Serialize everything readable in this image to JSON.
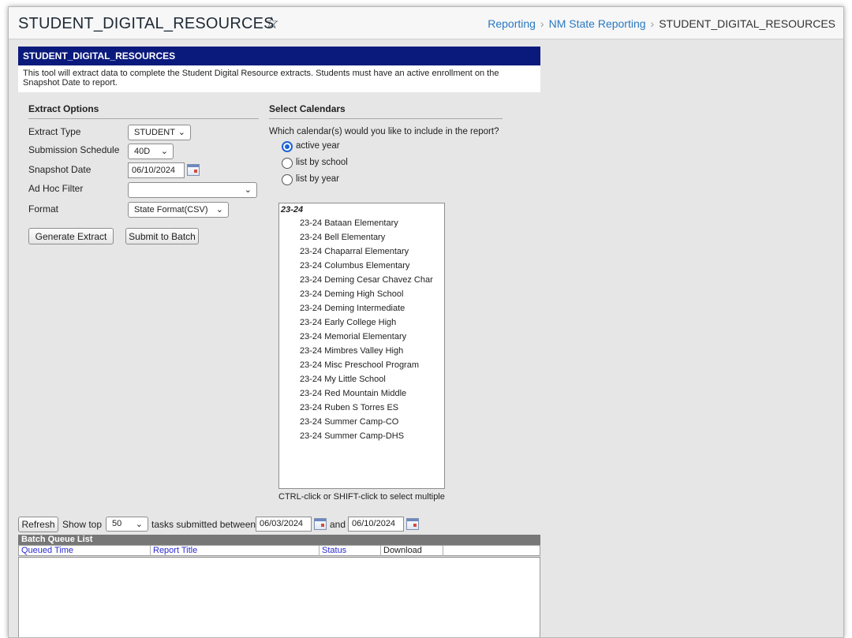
{
  "header": {
    "title": "STUDENT_DIGITAL_RESOURCES",
    "breadcrumb": [
      "Reporting",
      "NM State Reporting",
      "STUDENT_DIGITAL_RESOURCES"
    ]
  },
  "panel": {
    "title": "STUDENT_DIGITAL_RESOURCES",
    "description": "This tool will extract data to complete the Student Digital Resource extracts. Students must have an active enrollment on the Snapshot Date to report."
  },
  "extract_options": {
    "heading": "Extract Options",
    "extract_type_label": "Extract Type",
    "extract_type_value": "STUDENT",
    "submission_schedule_label": "Submission Schedule",
    "submission_schedule_value": "40D",
    "snapshot_date_label": "Snapshot Date",
    "snapshot_date_value": "06/10/2024",
    "ad_hoc_filter_label": "Ad Hoc Filter",
    "ad_hoc_filter_value": "",
    "format_label": "Format",
    "format_value": "State Format(CSV)",
    "generate_button": "Generate Extract",
    "submit_batch_button": "Submit to Batch"
  },
  "calendars": {
    "heading": "Select Calendars",
    "question": "Which calendar(s) would you like to include in the report?",
    "options": [
      "active year",
      "list by school",
      "list by year"
    ],
    "selected": "active year",
    "group": "23-24",
    "items": [
      "23-24 Bataan Elementary",
      "23-24 Bell Elementary",
      "23-24 Chaparral Elementary",
      "23-24 Columbus Elementary",
      "23-24 Deming Cesar Chavez Char",
      "23-24 Deming High School",
      "23-24 Deming Intermediate",
      "23-24 Early College High",
      "23-24 Memorial Elementary",
      "23-24 Mimbres Valley High",
      "23-24 Misc Preschool Program",
      "23-24 My Little School",
      "23-24 Red Mountain Middle",
      "23-24 Ruben S Torres ES",
      "23-24 Summer Camp-CO",
      "23-24 Summer Camp-DHS"
    ],
    "hint": "CTRL-click or SHIFT-click to select multiple"
  },
  "batch": {
    "refresh_button": "Refresh",
    "show_top_label": "Show top",
    "show_top_value": "50",
    "between_label": "tasks submitted between",
    "start_date": "06/03/2024",
    "and_label": "and",
    "end_date": "06/10/2024",
    "list_title": "Batch Queue List",
    "columns": [
      "Queued Time",
      "Report Title",
      "Status",
      "Download"
    ]
  }
}
